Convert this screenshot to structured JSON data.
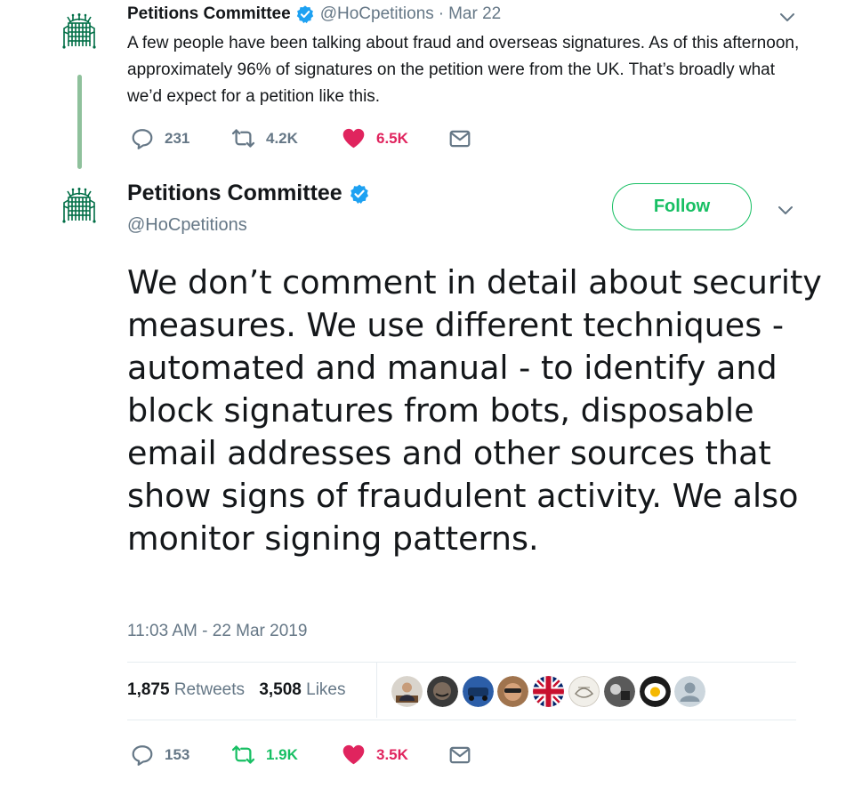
{
  "first_tweet": {
    "author_name": "Petitions Committee",
    "handle": "@HoCpetitions",
    "separator": "·",
    "date": "Mar 22",
    "text": "A few people have been talking about fraud and overseas signatures. As of this afternoon, approximately 96% of signatures on the petition were from the UK. That’s broadly what we’d expect for a petition like this.",
    "replies": "231",
    "retweets": "4.2K",
    "likes": "6.5K"
  },
  "main_tweet": {
    "author_name": "Petitions Committee",
    "handle": "@HoCpetitions",
    "follow_label": "Follow",
    "text": "We don’t comment in detail about security measures. We use different techniques - automated and manual - to identify and block signatures from bots, disposable email addresses and other sources that show signs of fraudulent activity. We also monitor signing patterns.",
    "timestamp": "11:03 AM - 22 Mar 2019",
    "retweet_count": "1,875",
    "retweet_label": "Retweets",
    "like_count": "3,508",
    "like_label": "Likes",
    "replies": "153",
    "retweets": "1.9K",
    "likes": "3.5K"
  },
  "liker_avatars": [
    "person-at-desk",
    "person-laughing",
    "blue-car",
    "person-with-sunglasses",
    "union-jack-flag",
    "drawing-sketch",
    "black-and-white-photo",
    "fried-egg",
    "default-profile"
  ],
  "colors": {
    "name": "#14171a",
    "secondary": "#657786",
    "accent_green": "#17bf63",
    "like_red": "#e0245e",
    "verified_blue": "#1da1f2",
    "portcullis_green": "#006e46",
    "thread_line": "#8fc19c"
  },
  "icons": [
    "portcullis-logo-icon",
    "verified-badge-icon",
    "chevron-down-icon",
    "reply-icon",
    "retweet-icon",
    "heart-icon",
    "mail-icon"
  ]
}
